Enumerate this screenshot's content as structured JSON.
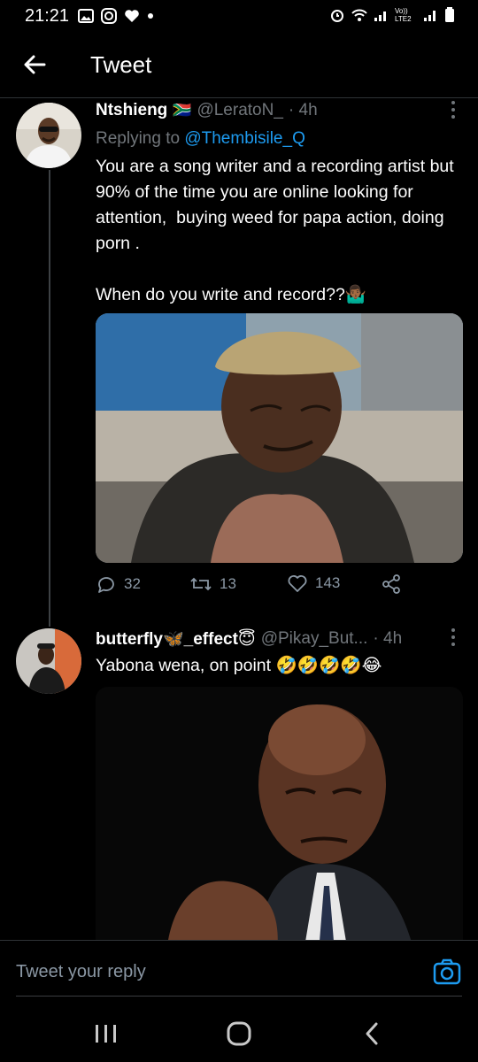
{
  "status": {
    "time": "21:21",
    "network_label": "Vo)) LTE2"
  },
  "header": {
    "title": "Tweet"
  },
  "tweet": {
    "name": "Ntshieng",
    "flag": "🇿🇦",
    "handle": "@LeratoN_",
    "dot_time": "· 4h",
    "replying_prefix": "Replying to",
    "replying_to": "@Thembisile_Q",
    "text": "You are a song writer and a recording artist but 90% of the time you are online looking for attention,  buying weed for papa action, doing porn .\n\nWhen do you write and record??🤷🏾‍♂️",
    "replies": "32",
    "retweets": "13",
    "likes": "143"
  },
  "reply": {
    "name": "butterfly🦋_effect😇",
    "handle": "@Pikay_But...",
    "dot_time": "· 4h",
    "text": "Yabona wena, on point 🤣🤣🤣🤣😂"
  },
  "composer": {
    "placeholder": "Tweet your reply"
  },
  "colors": {
    "accent": "#1d9bf0",
    "muted": "#71767b",
    "background": "#000000"
  }
}
